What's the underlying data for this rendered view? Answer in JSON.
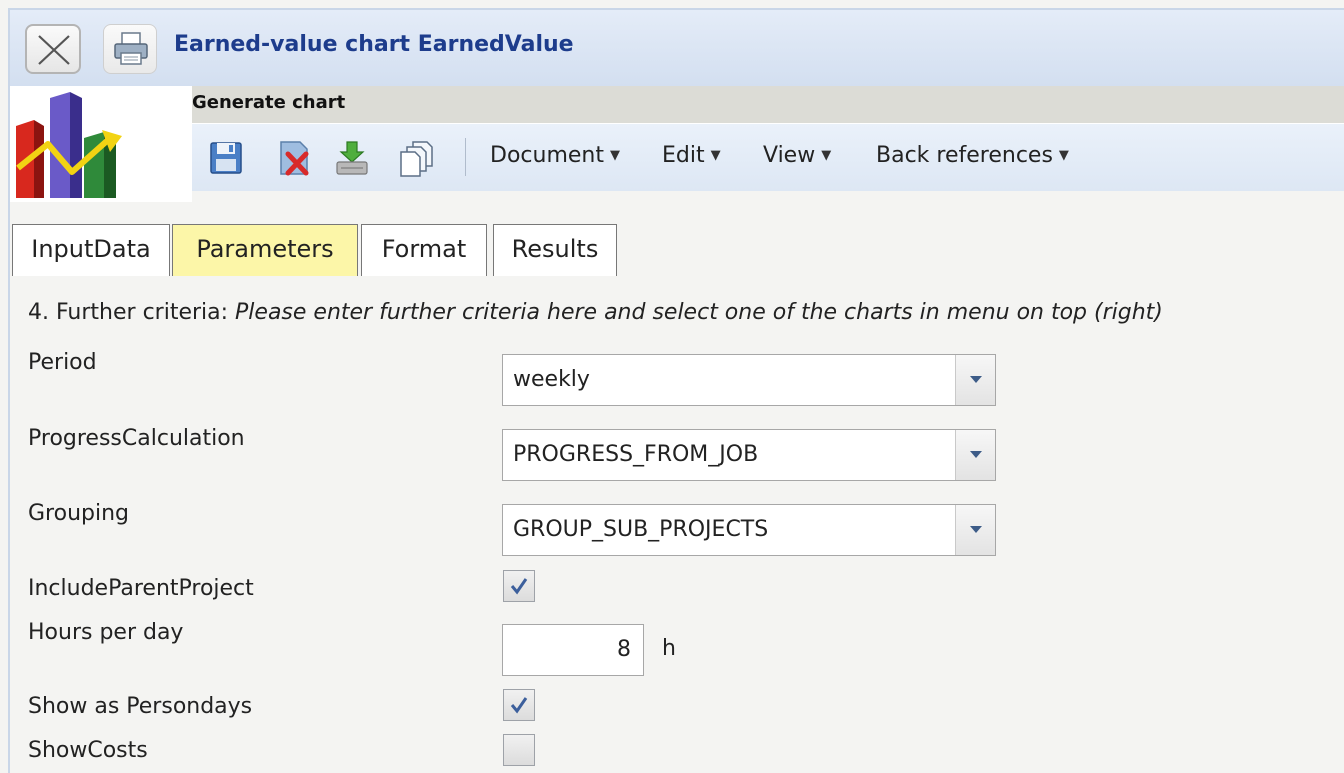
{
  "window": {
    "title": "Earned-value chart EarnedValue"
  },
  "toolbar": {
    "section_label": "Generate chart",
    "icons": [
      "save-icon",
      "delete-icon",
      "download-icon",
      "copy-icon"
    ],
    "menus": [
      {
        "label": "Document"
      },
      {
        "label": "Edit"
      },
      {
        "label": "View"
      },
      {
        "label": "Back references"
      }
    ]
  },
  "tabs": [
    {
      "label": "InputData",
      "active": false
    },
    {
      "label": "Parameters",
      "active": true
    },
    {
      "label": "Format",
      "active": false
    },
    {
      "label": "Results",
      "active": false
    }
  ],
  "form": {
    "heading_prefix": "4. Further criteria: ",
    "heading_hint": "Please enter further criteria here and select one of the charts in menu on top (right)",
    "period": {
      "label": "Period",
      "value": "weekly"
    },
    "progress_calculation": {
      "label": "ProgressCalculation",
      "value": "PROGRESS_FROM_JOB"
    },
    "grouping": {
      "label": "Grouping",
      "value": "GROUP_SUB_PROJECTS"
    },
    "include_parent_project": {
      "label": "IncludeParentProject",
      "checked": true
    },
    "hours_per_day": {
      "label": "Hours per day",
      "value": "8",
      "unit": "h"
    },
    "show_as_persondays": {
      "label": "Show as Persondays",
      "checked": true
    },
    "show_costs": {
      "label": "ShowCosts",
      "checked": false
    }
  },
  "colors": {
    "title_text": "#1d3c8c",
    "active_tab": "#fcf6a8",
    "toolbar_bg": "#dde7f4"
  }
}
